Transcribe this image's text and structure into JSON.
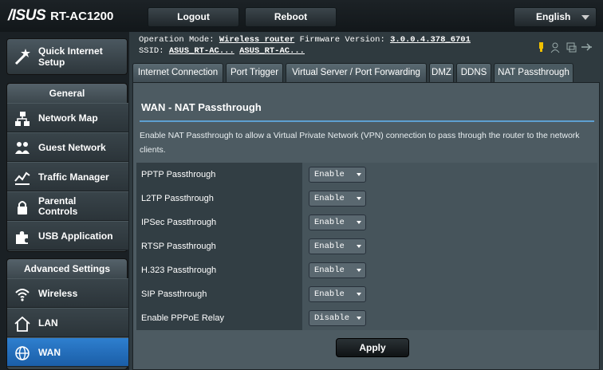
{
  "header": {
    "brand": "/ISUS",
    "model": "RT-AC1200",
    "logout_label": "Logout",
    "reboot_label": "Reboot",
    "language": "English"
  },
  "sidebar": {
    "quick_setup": "Quick Internet Setup",
    "general_title": "General",
    "general_items": [
      "Network Map",
      "Guest Network",
      "Traffic Manager",
      "Parental Controls",
      "USB Application"
    ],
    "advanced_title": "Advanced Settings",
    "advanced_items": [
      "Wireless",
      "LAN",
      "WAN"
    ],
    "active_item": "WAN"
  },
  "status": {
    "op_mode_label": "Operation Mode:",
    "op_mode_value": "Wireless router",
    "fw_label": "Firmware Version:",
    "fw_value": "3.0.0.4.378_6701",
    "ssid_label": "SSID:",
    "ssid_1": "ASUS_RT-AC...",
    "ssid_2": "ASUS_RT-AC..."
  },
  "tabs": [
    "Internet Connection",
    "Port Trigger",
    "Virtual Server / Port Forwarding",
    "DMZ",
    "DDNS",
    "NAT Passthrough"
  ],
  "active_tab": "NAT Passthrough",
  "panel": {
    "title": "WAN - NAT Passthrough",
    "description": "Enable NAT Passthrough to allow a Virtual Private Network (VPN) connection to pass through the router to the network clients.",
    "rows": [
      {
        "label": "PPTP Passthrough",
        "value": "Enable"
      },
      {
        "label": "L2TP Passthrough",
        "value": "Enable"
      },
      {
        "label": "IPSec Passthrough",
        "value": "Enable"
      },
      {
        "label": "RTSP Passthrough",
        "value": "Enable"
      },
      {
        "label": "H.323 Passthrough",
        "value": "Enable"
      },
      {
        "label": "SIP Passthrough",
        "value": "Enable"
      },
      {
        "label": "Enable PPPoE Relay",
        "value": "Disable"
      }
    ],
    "apply_label": "Apply"
  },
  "colors": {
    "accent": "#5e9fd0",
    "active_nav": "#2e7fcf",
    "status_icon": "#f0c000"
  },
  "icons": [
    "wand-icon",
    "network-map-icon",
    "guest-network-icon",
    "traffic-manager-icon",
    "lock-icon",
    "puzzle-icon",
    "wifi-icon",
    "home-icon",
    "globe-icon"
  ]
}
